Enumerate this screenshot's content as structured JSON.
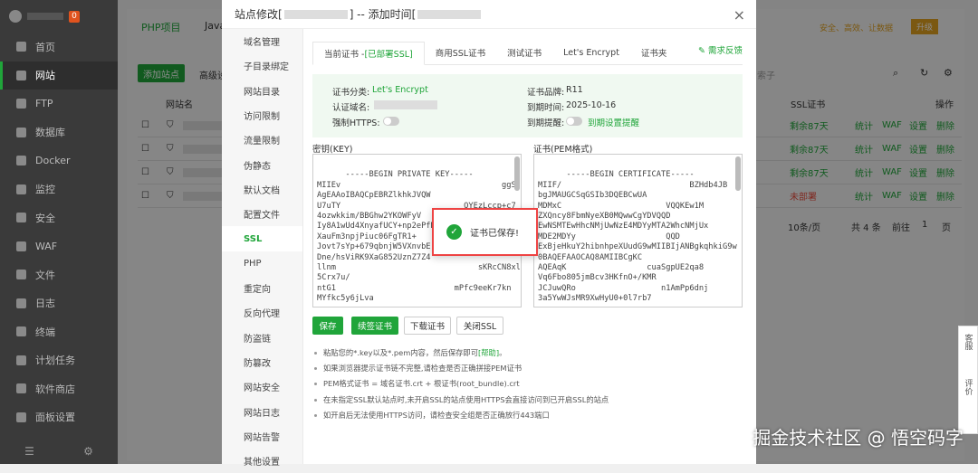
{
  "sidebar": {
    "badge": "0",
    "items": [
      "首页",
      "网站",
      "FTP",
      "数据库",
      "Docker",
      "监控",
      "安全",
      "WAF",
      "文件",
      "日志",
      "终端",
      "计划任务",
      "软件商店",
      "面板设置"
    ]
  },
  "background": {
    "tabs": [
      "PHP项目",
      "Java"
    ],
    "add_site": "添加站点",
    "adv": "高级设",
    "search_placeholder": "索子",
    "col_site": "网站名",
    "col_ssl": "SSL证书",
    "col_ops": "操作",
    "rows": [
      {
        "ssl": "剩余87天",
        "ssl_color": "green"
      },
      {
        "ssl": "剩余87天",
        "ssl_color": "green"
      },
      {
        "ssl": "剩余87天",
        "ssl_color": "green"
      },
      {
        "ssl": "未部署",
        "ssl_color": "red"
      }
    ],
    "row_ops": [
      "统计",
      "WAF",
      "设置",
      "删除"
    ],
    "pager": {
      "per_page": "10条/页",
      "total": "共 4 条",
      "goto": "前往",
      "page": "1",
      "suffix": "页"
    },
    "top_right": {
      "secure": "安全、高效、让数据",
      "upgrade": "升级"
    }
  },
  "modal": {
    "title_prefix": "站点修改[",
    "title_mid": "] -- 添加时间[",
    "close": "×",
    "nav": [
      "域名管理",
      "子目录绑定",
      "网站目录",
      "访问限制",
      "流量限制",
      "伪静态",
      "默认文档",
      "配置文件",
      "SSL",
      "PHP",
      "重定向",
      "反向代理",
      "防盗链",
      "防篡改",
      "网站安全",
      "网站日志",
      "网站告警",
      "其他设置"
    ],
    "active_nav": "SSL",
    "tabs": {
      "current_prefix": "当前证书 - ",
      "current_status": "[已部署SSL]",
      "commercial": "商用SSL证书",
      "test": "测试证书",
      "letsencrypt": "Let's Encrypt",
      "folder": "证书夹"
    },
    "feedback": "需求反馈",
    "info": {
      "cert_type_label": "证书分类:",
      "cert_type": "Let's Encrypt",
      "brand_label": "证书品牌:",
      "brand": "R11",
      "domain_label": "认证域名:",
      "expire_label": "到期时间:",
      "expire": "2025-10-16",
      "https_label": "强制HTTPS:",
      "remind_label": "到期提醒:",
      "remind_link": "到期设置提醒"
    },
    "key_label": "密钥(KEY)",
    "cert_label": "证书(PEM格式)",
    "key_text": "-----BEGIN PRIVATE KEY-----\nMIIEv                                  ggSj\nAgEAAoIBAQCpEBRZlkhkJVQW\nU7uTY                          QYEzLccp+c7\n4ozwkkim/BBGhw2YKOWFyV\nIy8A1wUd4XnyafUCY+np2ePfN\nXauFm3npjPiuc06FgTR1+\nJovt7sYp+679qbnjW5VXnvbE\nDne/hsViRK9XaG852UznZ7Z4\nllnm                              sKRcCN8xl\n5Crx7u/                          \nntG1                         mPfc9eeKr7kn\nMYfkc5y6jLva              ",
    "cert_text": "-----BEGIN CERTIFICATE-----\nMIIF/                           BZHdb4JB\nbgJMAUGCSqGSIb3DQEBCwUA\nMDMxC                      VQQKEw1M\nZXQncy8FbmNyeXB0MQwwCgYDVQQD\nEwNSMTEwHhcNMjUwNzE4MDYyMTA2WhcNMjUx\nMDE2MDYy                   QQD\nExBjeHkuY2hibnhpeXUudG9wMIIBIjANBgkqhkiG9w\n0BAQEFAAOCAQ8AMIIBCgKC\nAQEAqK                 cuaSgpUE2qa8\nVq6Fbo805jmBcv3HKfnO+/KMR\nJCJuwQRo                  n1AmPp6dnj\n3a5YwWJsMR9XwHyU0+0l7rb7",
    "buttons": {
      "save": "保存",
      "renew": "续签证书",
      "download": "下载证书",
      "close_ssl": "关闭SSL"
    },
    "tips": [
      {
        "text": "粘贴您的*.key以及*.pem内容，然后保存即可",
        "link": "[帮助]",
        "end": "。"
      },
      {
        "text": "如果浏览器提示证书链不完整,请检查是否正确拼接PEM证书",
        "link": "",
        "end": ""
      },
      {
        "text": "PEM格式证书 = 域名证书.crt + 根证书(root_bundle).crt",
        "link": "",
        "end": ""
      },
      {
        "text": "在未指定SSL默认站点时,未开启SSL的站点使用HTTPS会直接访问到已开启SSL的站点",
        "link": "",
        "end": ""
      },
      {
        "text": "如开启后无法使用HTTPS访问，请检查安全组是否正确放行443端口",
        "link": "",
        "end": ""
      }
    ]
  },
  "toast": {
    "message": "证书已保存!"
  },
  "float": {
    "service": "客服",
    "review": "评价"
  },
  "watermark": "掘金技术社区 @ 悟空码字"
}
